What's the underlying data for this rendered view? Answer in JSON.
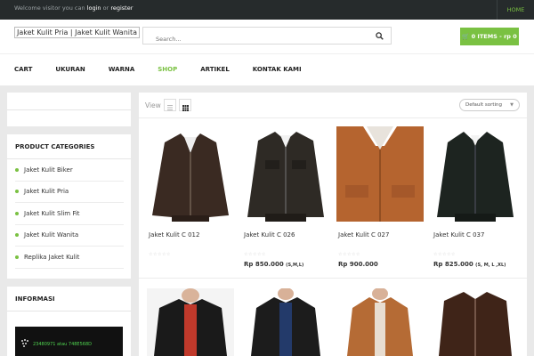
{
  "topbar": {
    "welcome_prefix": "Welcome visitor you can ",
    "login": "login",
    "or": " or ",
    "register": "register",
    "home": "HOME"
  },
  "header": {
    "logo_text": "Jaket Kulit Pria | Jaket Kulit Wanita",
    "search_placeholder": "Search...",
    "cart_label": "0 ITEMS - rp 0",
    "search_icon": "search-icon",
    "cart_icon": "shopping-cart-icon"
  },
  "nav": {
    "items": [
      "CART",
      "UKURAN",
      "WARNA",
      "SHOP",
      "ARTIKEL",
      "KONTAK KAMI"
    ],
    "active": "SHOP"
  },
  "sidebar": {
    "categories_title": "PRODUCT CATEGORIES",
    "categories": [
      "Jaket Kulit Biker",
      "Jaket Kulit Pria",
      "Jaket Kulit Slim Fit",
      "Jaket Kulit Wanita",
      "Replika Jaket Kulit"
    ],
    "info_title": "INFORMASI",
    "bb_text": "23480971 atau 748E568D"
  },
  "main": {
    "view_label": "View",
    "sort_label": "Default sorting",
    "products": [
      {
        "name": "Jaket Kulit C 012",
        "price": "",
        "size": "",
        "color": "#3a2a22"
      },
      {
        "name": "Jaket Kulit C 026",
        "price": "Rp 850.000",
        "size": "(S,M,L)",
        "color": "#2e2a25"
      },
      {
        "name": "Jaket Kulit C 027",
        "price": "Rp 900.000",
        "size": "",
        "color": "#b5642f"
      },
      {
        "name": "Jaket Kulit C 037",
        "price": "Rp 825.000",
        "size": "(S, M, L ,XL)",
        "color": "#1d2420"
      }
    ],
    "row2_colors": [
      "#1a1a1a",
      "#1c1c1c",
      "#b56b35",
      "#3f2418"
    ]
  },
  "colors": {
    "accent": "#7ac142",
    "topbar": "#262b2c",
    "page_bg": "#e9e9e9"
  }
}
